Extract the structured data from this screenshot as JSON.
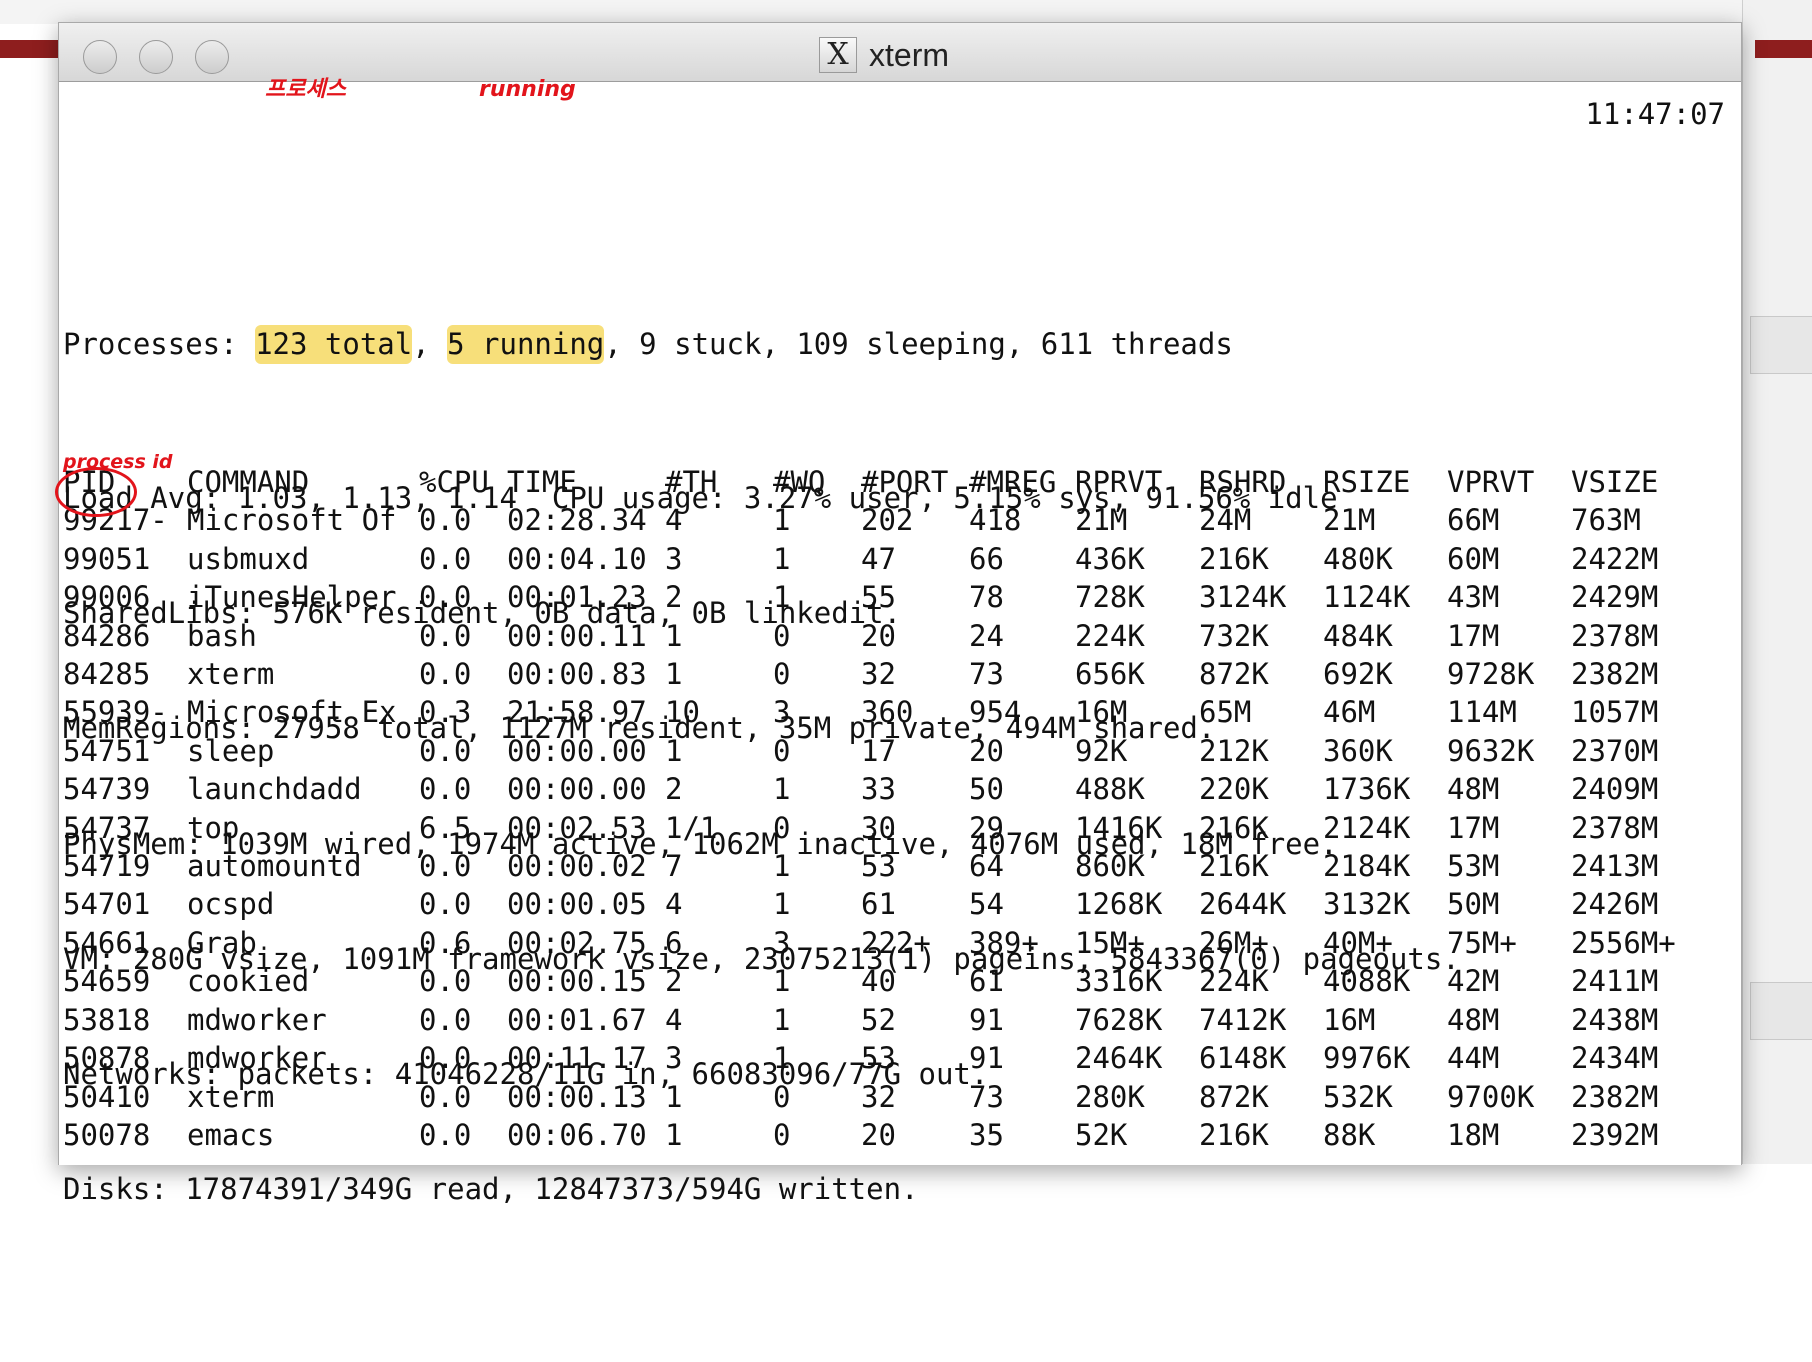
{
  "window": {
    "title": "xterm"
  },
  "summary": {
    "processes_label": "Processes: ",
    "total": "123 total",
    "sep": ", ",
    "running": "5 running",
    "rest": ", 9 stuck, 109 sleeping, 611 threads",
    "time": "11:47:07",
    "lines": [
      "Load Avg: 1.03, 1.13, 1.14  CPU usage: 3.27% user, 5.15% sys, 91.56% idle",
      "SharedLibs: 576K resident, 0B data, 0B linkedit.",
      "MemRegions: 27958 total, 1127M resident, 35M private, 494M shared.",
      "PhysMem: 1039M wired, 1974M active, 1062M inactive, 4076M used, 18M free.",
      "VM: 280G vsize, 1091M framework vsize, 23075213(1) pageins, 5843367(0) pageouts.",
      "Networks: packets: 41046228/11G in, 66083096/77G out.",
      "Disks: 17874391/349G read, 12847373/594G written."
    ]
  },
  "annotations": {
    "total_note": "프로세스",
    "running_note": "running",
    "pid_note": "process id"
  },
  "columns": [
    "PID",
    "COMMAND",
    "%CPU",
    "TIME",
    "#TH",
    "#WQ",
    "#PORT",
    "#MREG",
    "RPRVT",
    "RSHRD",
    "RSIZE",
    "VPRVT",
    "VSIZE"
  ],
  "rows": [
    [
      "99217-",
      "Microsoft Of",
      "0.0",
      "02:28.34",
      "4",
      "1",
      "202",
      "418",
      "21M",
      "24M",
      "21M",
      "66M",
      "763M"
    ],
    [
      "99051",
      "usbmuxd",
      "0.0",
      "00:04.10",
      "3",
      "1",
      "47",
      "66",
      "436K",
      "216K",
      "480K",
      "60M",
      "2422M"
    ],
    [
      "99006",
      "iTunesHelper",
      "0.0",
      "00:01.23",
      "2",
      "1",
      "55",
      "78",
      "728K",
      "3124K",
      "1124K",
      "43M",
      "2429M"
    ],
    [
      "84286",
      "bash",
      "0.0",
      "00:00.11",
      "1",
      "0",
      "20",
      "24",
      "224K",
      "732K",
      "484K",
      "17M",
      "2378M"
    ],
    [
      "84285",
      "xterm",
      "0.0",
      "00:00.83",
      "1",
      "0",
      "32",
      "73",
      "656K",
      "872K",
      "692K",
      "9728K",
      "2382M"
    ],
    [
      "55939-",
      "Microsoft Ex",
      "0.3",
      "21:58.97",
      "10",
      "3",
      "360",
      "954",
      "16M",
      "65M",
      "46M",
      "114M",
      "1057M"
    ],
    [
      "54751",
      "sleep",
      "0.0",
      "00:00.00",
      "1",
      "0",
      "17",
      "20",
      "92K",
      "212K",
      "360K",
      "9632K",
      "2370M"
    ],
    [
      "54739",
      "launchdadd",
      "0.0",
      "00:00.00",
      "2",
      "1",
      "33",
      "50",
      "488K",
      "220K",
      "1736K",
      "48M",
      "2409M"
    ],
    [
      "54737",
      "top",
      "6.5",
      "00:02.53",
      "1/1",
      "0",
      "30",
      "29",
      "1416K",
      "216K",
      "2124K",
      "17M",
      "2378M"
    ],
    [
      "54719",
      "automountd",
      "0.0",
      "00:00.02",
      "7",
      "1",
      "53",
      "64",
      "860K",
      "216K",
      "2184K",
      "53M",
      "2413M"
    ],
    [
      "54701",
      "ocspd",
      "0.0",
      "00:00.05",
      "4",
      "1",
      "61",
      "54",
      "1268K",
      "2644K",
      "3132K",
      "50M",
      "2426M"
    ],
    [
      "54661",
      "Grab",
      "0.6",
      "00:02.75",
      "6",
      "3",
      "222+",
      "389+",
      "15M+",
      "26M+",
      "40M+",
      "75M+",
      "2556M+"
    ],
    [
      "54659",
      "cookied",
      "0.0",
      "00:00.15",
      "2",
      "1",
      "40",
      "61",
      "3316K",
      "224K",
      "4088K",
      "42M",
      "2411M"
    ],
    [
      "53818",
      "mdworker",
      "0.0",
      "00:01.67",
      "4",
      "1",
      "52",
      "91",
      "7628K",
      "7412K",
      "16M",
      "48M",
      "2438M"
    ],
    [
      "50878",
      "mdworker",
      "0.0",
      "00:11.17",
      "3",
      "1",
      "53",
      "91",
      "2464K",
      "6148K",
      "9976K",
      "44M",
      "2434M"
    ],
    [
      "50410",
      "xterm",
      "0.0",
      "00:00.13",
      "1",
      "0",
      "32",
      "73",
      "280K",
      "872K",
      "532K",
      "9700K",
      "2382M"
    ],
    [
      "50078",
      "emacs",
      "0.0",
      "00:06.70",
      "1",
      "0",
      "20",
      "35",
      "52K",
      "216K",
      "88K",
      "18M",
      "2392M"
    ]
  ]
}
